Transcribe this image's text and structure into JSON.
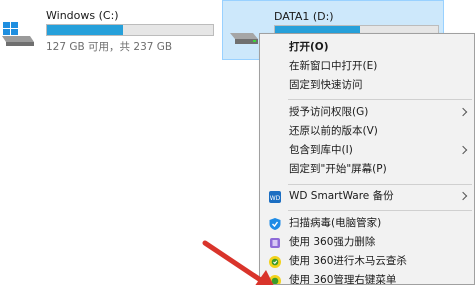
{
  "drives": [
    {
      "name": "Windows (C:)",
      "info": "127 GB 可用，共 237 GB",
      "used_fraction": 0.46,
      "selected": false
    },
    {
      "name": "DATA1 (D:)",
      "info": "",
      "used_fraction": 0.52,
      "selected": true
    }
  ],
  "context_menu": {
    "items": [
      {
        "label": "打开(O)",
        "bold": true
      },
      {
        "label": "在新窗口中打开(E)"
      },
      {
        "label": "固定到快速访问"
      },
      {
        "label": "授予访问权限(G)",
        "submenu": true
      },
      {
        "label": "还原以前的版本(V)"
      },
      {
        "label": "包含到库中(I)",
        "submenu": true
      },
      {
        "label": "固定到\"开始\"屏幕(P)"
      },
      {
        "label": "WD SmartWare 备份",
        "submenu": true,
        "icon": "wd-icon"
      },
      {
        "label": "扫描病毒(电脑管家)",
        "icon": "shield-icon"
      },
      {
        "label": "使用 360强力删除",
        "icon": "360-delete-icon"
      },
      {
        "label": "使用 360进行木马云查杀",
        "icon": "360-scan-icon"
      },
      {
        "label": "使用 360管理右键菜单",
        "icon": "360-menu-icon"
      }
    ]
  },
  "colors": {
    "selection": "#cde8fb",
    "capacity_fill": "#26a0da",
    "menu_bg": "#f2f2f2",
    "annotation_arrow": "#d9342b"
  }
}
